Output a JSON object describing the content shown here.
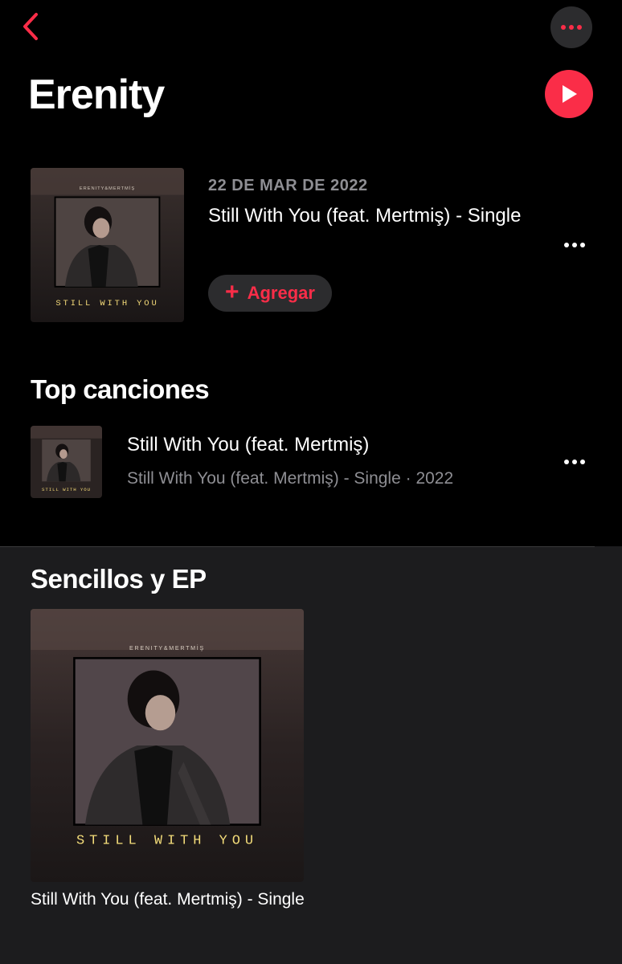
{
  "nav": {
    "back_icon": "chevron-left-icon",
    "more_icon": "ellipsis-icon",
    "accent": "#fa2d48"
  },
  "artist": {
    "name": "Erenity",
    "play_icon": "play-icon"
  },
  "latest_release": {
    "date": "22 DE MAR DE 2022",
    "title": "Still With You (feat. Mertmiş) - Single",
    "add_label": "Agregar",
    "cover_header": "ERENITY&MERTMİŞ",
    "cover_text": "STILL WITH YOU"
  },
  "top_songs": {
    "heading": "Top canciones",
    "items": [
      {
        "title": "Still With You (feat. Mertmiş)",
        "subtitle": "Still With You (feat. Mertmiş) - Single · 2022"
      }
    ]
  },
  "singles": {
    "heading": "Sencillos y EP",
    "items": [
      {
        "caption": "Still With You (feat. Mertmiş) - Single",
        "cover_header": "ERENITY&MERTMİŞ",
        "cover_text": "STILL WITH YOU"
      }
    ]
  }
}
